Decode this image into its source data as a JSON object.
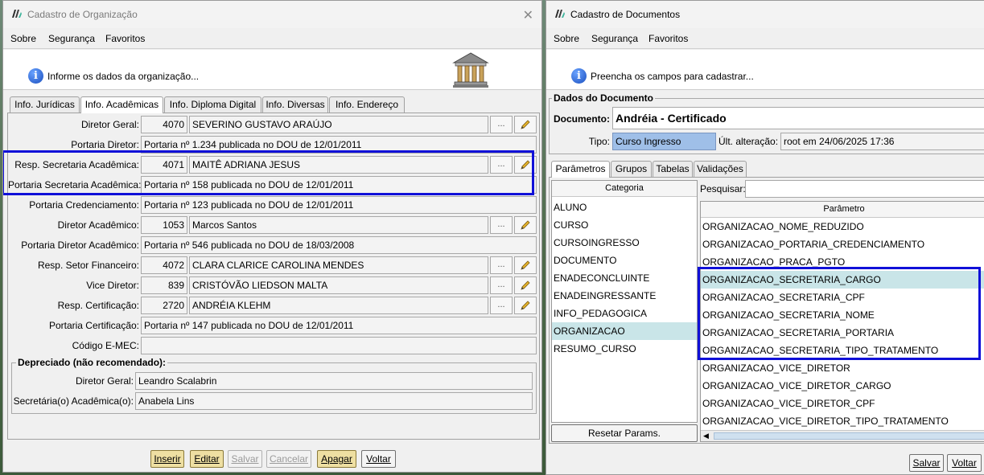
{
  "left_window": {
    "title": "Cadastro de Organização",
    "menu": [
      "Sobre",
      "Segurança",
      "Favoritos"
    ],
    "info": "Informe os dados da organização...",
    "tabs": [
      "Info. Jurídicas",
      "Info. Acadêmicas",
      "Info. Diploma Digital",
      "Info. Diversas",
      "Info. Endereço"
    ],
    "active_tab": "Info. Acadêmicas",
    "fields": {
      "diretor_geral": {
        "label": "Diretor Geral:",
        "code": "4070",
        "name": "SEVERINO GUSTAVO ARAÚJO"
      },
      "portaria_diretor": {
        "label": "Portaria Diretor:",
        "value": "Portaria nº 1.234 publicada no DOU de 12/01/2011"
      },
      "resp_secretaria": {
        "label": "Resp. Secretaria Acadêmica:",
        "code": "4071",
        "name": "MAITÊ ADRIANA JESUS"
      },
      "portaria_secretaria": {
        "label": "Portaria Secretaria Acadêmica:",
        "value": "Portaria nº 158 publicada no DOU de 12/01/2011"
      },
      "portaria_credenciamento": {
        "label": "Portaria Credenciamento:",
        "value": "Portaria nº 123 publicada no DOU de 12/01/2011"
      },
      "diretor_academico": {
        "label": "Diretor Acadêmico:",
        "code": "1053",
        "name": "Marcos Santos"
      },
      "portaria_diretor_academico": {
        "label": "Portaria Diretor Acadêmico:",
        "value": "Portaria nº 546 publicada no DOU de 18/03/2008"
      },
      "resp_setor_financeiro": {
        "label": "Resp. Setor Financeiro:",
        "code": "4072",
        "name": "CLARA CLARICE CAROLINA MENDES"
      },
      "vice_diretor": {
        "label": "Vice Diretor:",
        "code": "839",
        "name": "CRISTÓVÃO LIEDSON MALTA"
      },
      "resp_certificacao": {
        "label": "Resp. Certificação:",
        "code": "2720",
        "name": "ANDRÉIA KLEHM"
      },
      "portaria_certificacao": {
        "label": "Portaria Certificação:",
        "value": "Portaria nº 147 publicada no DOU de 12/01/2011"
      },
      "codigo_emec": {
        "label": "Código E-MEC:",
        "value": ""
      }
    },
    "lookup_label": "...",
    "deprecated": {
      "title": "Depreciado (não recomendado):",
      "diretor_geral_label": "Diretor Geral:",
      "diretor_geral": "Leandro Scalabrin",
      "secretaria_label": "Secretária(o) Acadêmica(o):",
      "secretaria": "Anabela Lins"
    },
    "buttons": {
      "inserir": "Inserir",
      "editar": "Editar",
      "salvar": "Salvar",
      "cancelar": "Cancelar",
      "apagar": "Apagar",
      "voltar": "Voltar"
    }
  },
  "right_window": {
    "title": "Cadastro de Documentos",
    "menu": [
      "Sobre",
      "Segurança",
      "Favoritos"
    ],
    "info": "Preencha os campos para cadastrar...",
    "section_title": "Dados do Documento",
    "documento_label": "Documento:",
    "documento": "Andréia - Certificado",
    "tipo_label": "Tipo:",
    "tipo": "Curso Ingresso",
    "ultima_label": "Últ. alteração:",
    "ultima": "root em 24/06/2025 17:36",
    "tabs": [
      "Parâmetros",
      "Grupos",
      "Tabelas",
      "Validações"
    ],
    "active_tab": "Parâmetros",
    "categoria_header": "Categoria",
    "categorias": [
      "ALUNO",
      "CURSO",
      "CURSOINGRESSO",
      "DOCUMENTO",
      "ENADECONCLUINTE",
      "ENADEINGRESSANTE",
      "INFO_PEDAGOGICA",
      "ORGANIZACAO",
      "RESUMO_CURSO"
    ],
    "categoria_selected": "ORGANIZACAO",
    "pesquisar_label": "Pesquisar:",
    "parametro_header": "Parâmetro",
    "parametros": [
      "ORGANIZACAO_NOME_REDUZIDO",
      "ORGANIZACAO_PORTARIA_CREDENCIAMENTO",
      "ORGANIZACAO_PRACA_PGTO",
      "ORGANIZACAO_SECRETARIA_CARGO",
      "ORGANIZACAO_SECRETARIA_CPF",
      "ORGANIZACAO_SECRETARIA_NOME",
      "ORGANIZACAO_SECRETARIA_PORTARIA",
      "ORGANIZACAO_SECRETARIA_TIPO_TRATAMENTO",
      "ORGANIZACAO_VICE_DIRETOR",
      "ORGANIZACAO_VICE_DIRETOR_CARGO",
      "ORGANIZACAO_VICE_DIRETOR_CPF",
      "ORGANIZACAO_VICE_DIRETOR_TIPO_TRATAMENTO"
    ],
    "parametro_selected": "ORGANIZACAO_SECRETARIA_CARGO",
    "resetar": "Resetar Params.",
    "buttons": {
      "salvar": "Salvar",
      "voltar": "Voltar"
    }
  }
}
